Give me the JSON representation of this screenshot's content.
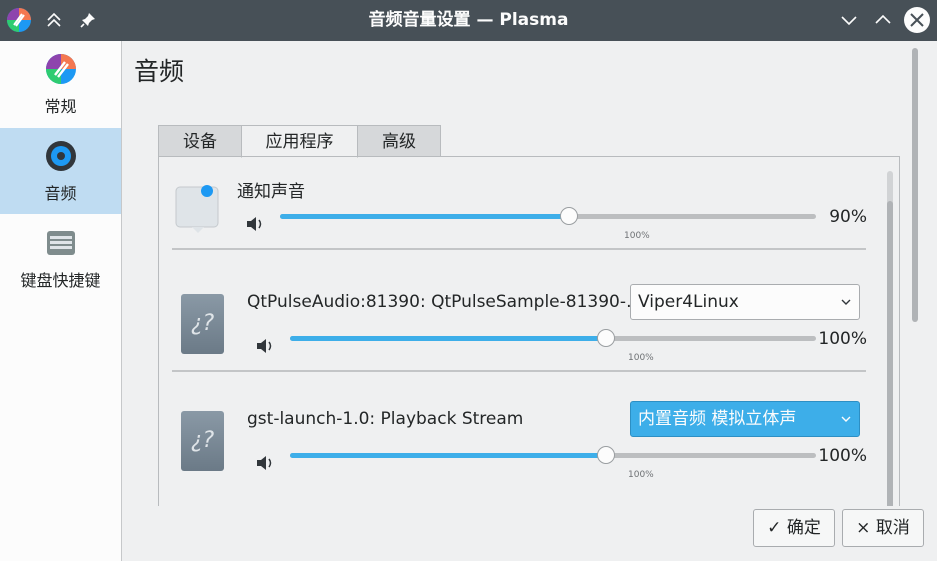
{
  "window": {
    "title": "音频音量设置 — Plasma"
  },
  "sidebar": {
    "items": [
      {
        "label": "常规",
        "icon": "plasma-logo-icon",
        "active": false
      },
      {
        "label": "音频",
        "icon": "audio-settings-icon",
        "active": true
      },
      {
        "label": "键盘快捷键",
        "icon": "keyboard-icon",
        "active": false
      }
    ]
  },
  "page": {
    "title": "音频"
  },
  "tabs": [
    {
      "label": "设备",
      "active": false
    },
    {
      "label": "应用程序",
      "active": true
    },
    {
      "label": "高级",
      "active": false
    }
  ],
  "streams": [
    {
      "name": "通知声音",
      "icon": "notification-icon",
      "volume_percent": 90,
      "volume_label": "90%",
      "tick_label": "100%",
      "device": null
    },
    {
      "name": "QtPulseAudio:81390: QtPulseSample-81390-…",
      "icon": "unknown-app-icon",
      "volume_percent": 100,
      "volume_label": "100%",
      "tick_label": "100%",
      "device": "Viper4Linux",
      "device_highlighted": false
    },
    {
      "name": "gst-launch-1.0: Playback Stream",
      "icon": "unknown-app-icon",
      "volume_percent": 100,
      "volume_label": "100%",
      "tick_label": "100%",
      "device": "内置音频 模拟立体声",
      "device_highlighted": true
    }
  ],
  "unknown_icon_glyph": "¿?",
  "buttons": {
    "ok": "✓ 确定",
    "cancel": "× 取消"
  },
  "colors": {
    "accent": "#3daee9",
    "titlebar": "#475057",
    "sidebar_active": "#bfdcf2"
  }
}
